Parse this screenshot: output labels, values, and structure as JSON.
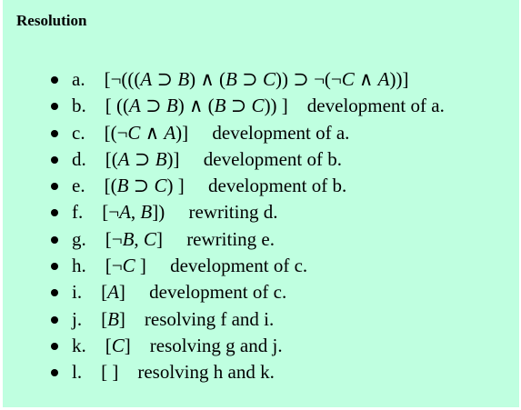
{
  "title": "Resolution",
  "steps": [
    {
      "prefix": "a.    [¬(((",
      "mid": "",
      "text": "a.    [¬(((A ⊃ B) ∧ (B ⊃ C)) ⊃ ¬(¬C ∧ A))]",
      "expr": "a.    [¬(((A ⊃ B) ∧ (B ⊃ C)) ⊃ ¬(¬C ∧ A))]",
      "note": ""
    },
    {
      "expr": "b.    [ ((A ⊃ B) ∧ (B ⊃ C)) ]",
      "note": "development of a."
    },
    {
      "expr": "c.    [(¬C ∧ A)]",
      "note": "development of a."
    },
    {
      "expr": "d.    [(A ⊃ B)]",
      "note": "development of b."
    },
    {
      "expr": "e.    [(B ⊃ C) ]",
      "note": "development of b."
    },
    {
      "expr": "f.    [¬A, B])",
      "note": "rewriting d."
    },
    {
      "expr": "g.    [¬B, C]",
      "note": "rewriting e."
    },
    {
      "expr": "h.    [¬C ]",
      "note": "development of c."
    },
    {
      "expr": "i.    [A]",
      "note": "development of c."
    },
    {
      "expr": "j.    [B]",
      "note": "resolving f and i."
    },
    {
      "expr": "k.    [C]",
      "note": "resolving g and j."
    },
    {
      "expr": "l.    [ ]",
      "note": "resolving h and k."
    }
  ]
}
